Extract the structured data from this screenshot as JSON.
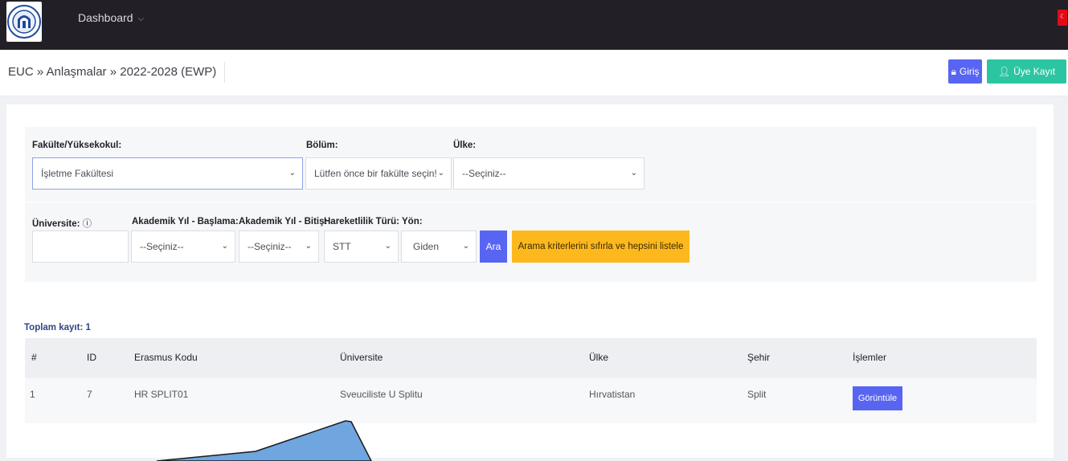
{
  "navbar": {
    "logo": "university-seal",
    "menu_label": "Dashboard",
    "flag": "turkey-flag"
  },
  "breadcrumb": "EUC » Anlaşmalar » 2022-2028 (EWP)",
  "auth": {
    "login_label": "Giriş",
    "register_label": "Üye Kayıt"
  },
  "filters": {
    "faculty": {
      "label": "Fakülte/Yüksekokul:",
      "value": "İşletme Fakültesi"
    },
    "department": {
      "label": "Bölüm:",
      "value": "Lütfen önce bir fakülte seçin!"
    },
    "country": {
      "label": "Ülke:",
      "value": "--Seçiniz--"
    },
    "university": {
      "label": "Üniversite:",
      "info_icon": "info-icon",
      "value": ""
    },
    "year_start": {
      "label": "Akademik Yıl - Başlama:",
      "value": "--Seçiniz--"
    },
    "year_end": {
      "label": "Akademik Yıl - Bitiş:",
      "value": "--Seçiniz--"
    },
    "mobility_type": {
      "label": "Hareketlilik Türü:",
      "value": "STT"
    },
    "direction": {
      "label": "Yön:",
      "value": "Giden"
    },
    "search_label": "Ara",
    "reset_label": "Arama kriterlerini sıfırla ve hepsini listele"
  },
  "results": {
    "total": "Toplam kayıt: 1",
    "columns": [
      "#",
      "ID",
      "Erasmus Kodu",
      "Üniversite",
      "Ülke",
      "Şehir",
      "İşlemler"
    ],
    "rows": [
      {
        "num": "1",
        "id": "7",
        "code": "HR SPLIT01",
        "university": "Sveuciliste U Splitu",
        "country": "Hırvatistan",
        "city": "Split",
        "action": "Görüntüle"
      }
    ]
  },
  "colors": {
    "topbar": "#221f26",
    "primary": "#5865f2",
    "success": "#2cc5a1",
    "warning": "#fdb81e",
    "annotation_arrow": "#6fa6e0"
  }
}
